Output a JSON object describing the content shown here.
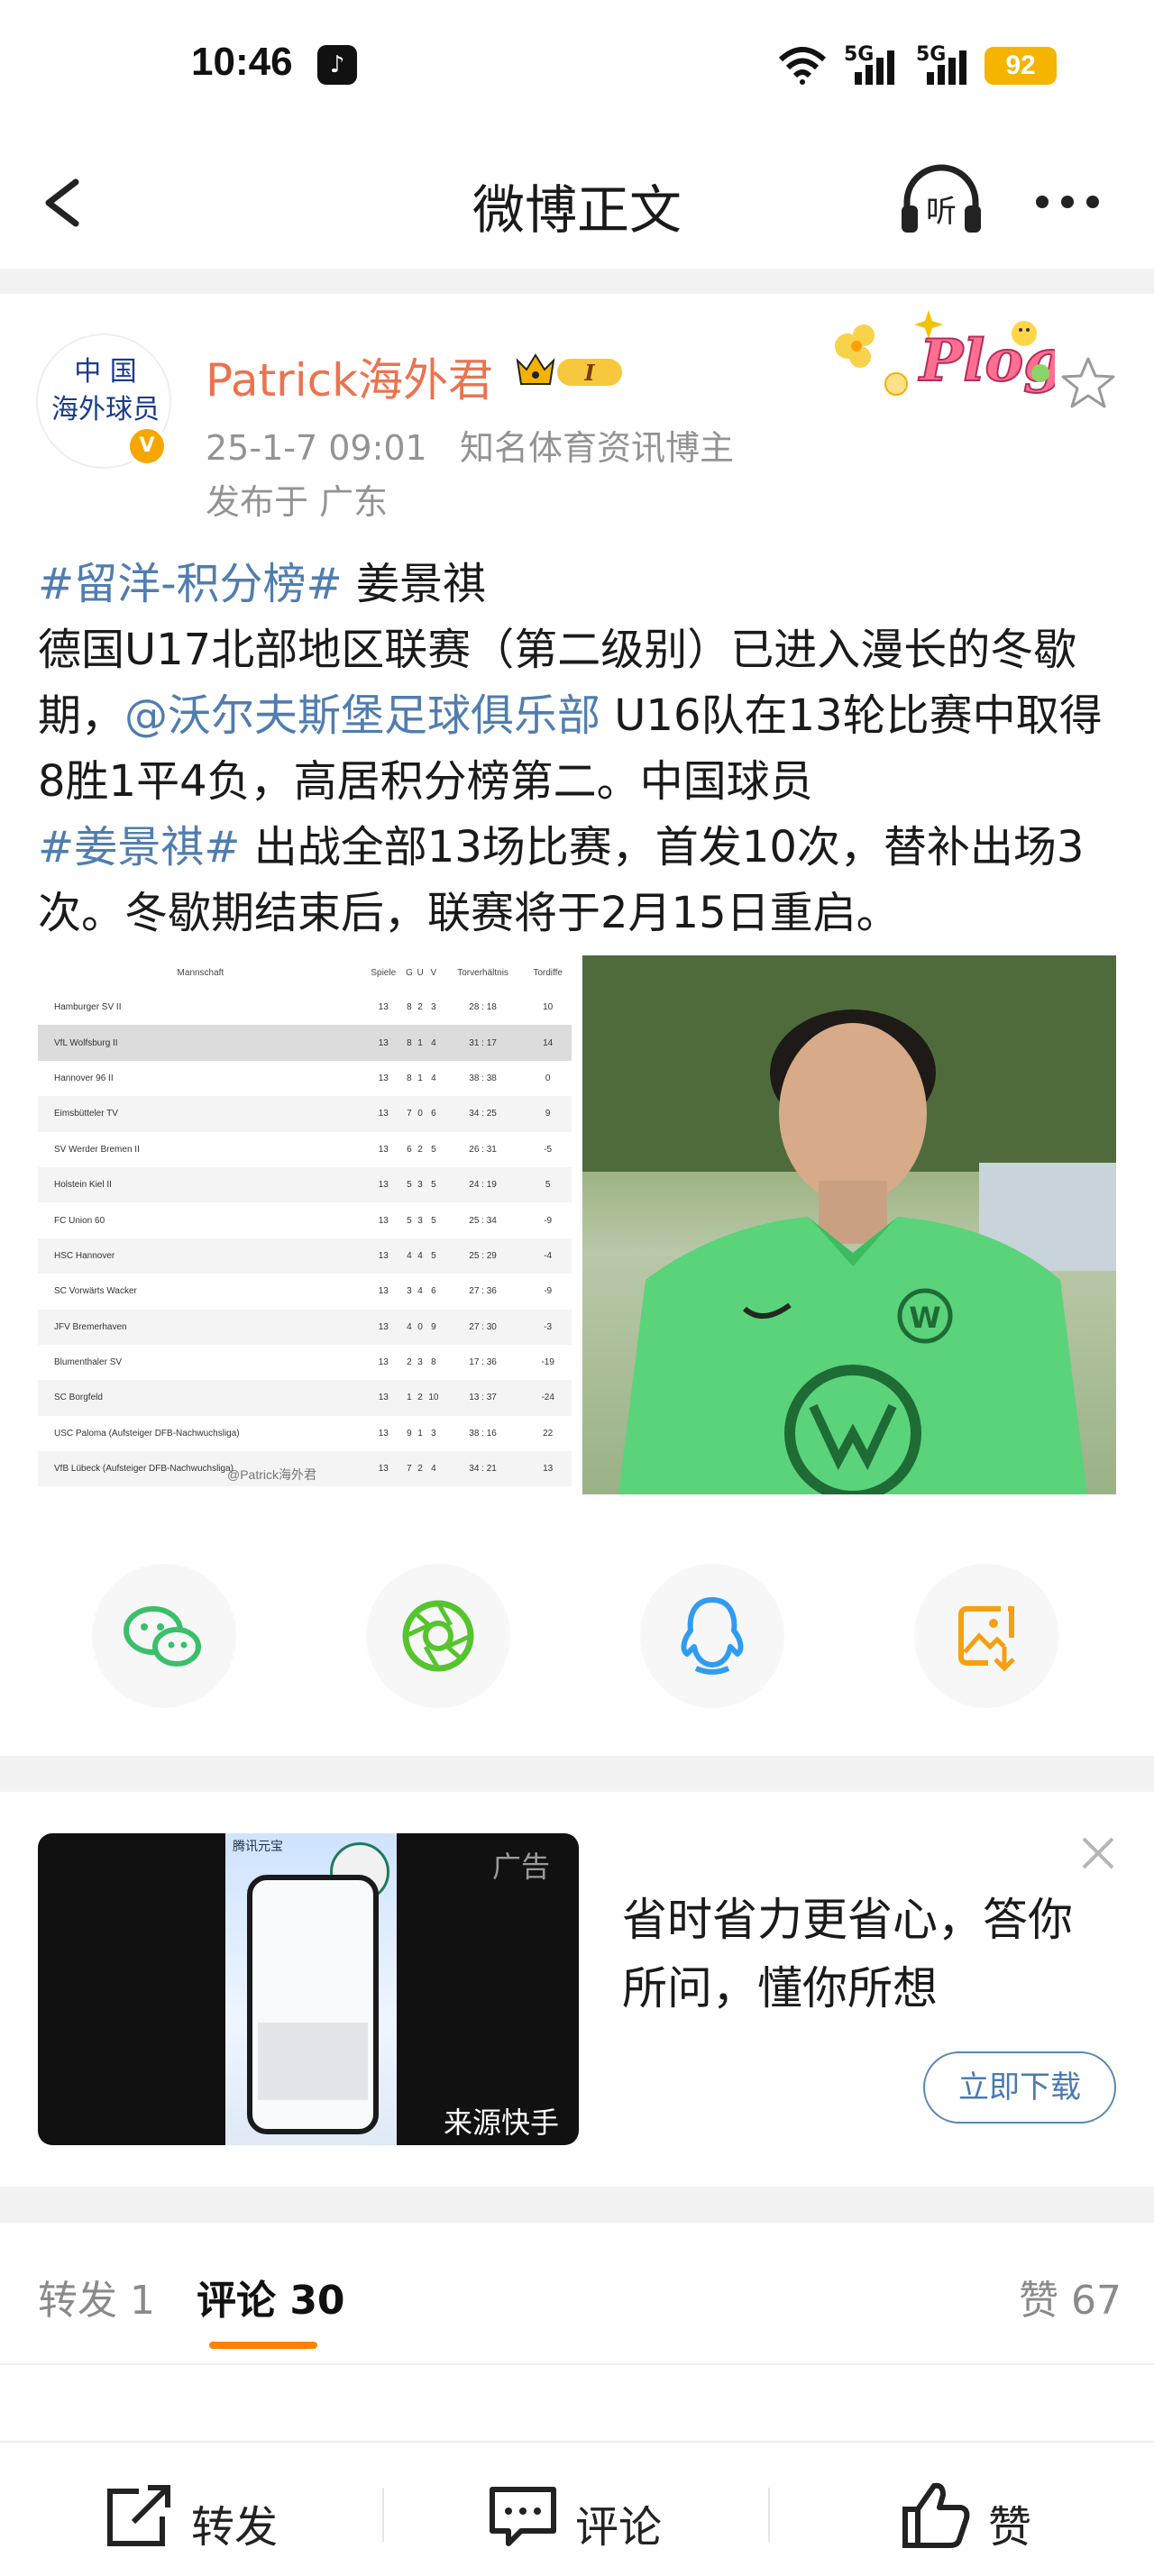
{
  "status_bar": {
    "time": "10:46",
    "signal1": "5G",
    "signal2": "5G",
    "battery": "92"
  },
  "nav": {
    "title": "微博正文"
  },
  "post": {
    "avatar_text_line1": "中 国",
    "avatar_text_line2": "海外球员",
    "username": "Patrick海外君",
    "vip_level": "I",
    "timestamp": "25-1-7 09:01",
    "author_title": "知名体育资讯博主",
    "location": "发布于 广东",
    "plog_label": "Plog",
    "body": {
      "tag1": "#留洋-积分榜#",
      "text1": " 姜景祺",
      "text2": "德国U17北部地区联赛（第二级别）已进入漫长的冬歇期，",
      "mention": "@沃尔夫斯堡足球俱乐部",
      "text3": " U16队在13轮比赛中取得8胜1平4负，高居积分榜第二。中国球员",
      "tag2": "#姜景祺#",
      "text4": " 出战全部13场比赛，首发10次，替补出场3次。冬歇期结束后，联赛将于2月15日重启。"
    },
    "table_image": {
      "headers": [
        "Mannschaft",
        "Spiele",
        "G",
        "U",
        "V",
        "Torverhältnis",
        "Tordiffe"
      ],
      "rows": [
        [
          "Hamburger SV II",
          "13",
          "8",
          "2",
          "3",
          "28 : 18",
          "10"
        ],
        [
          "VfL Wolfsburg II",
          "13",
          "8",
          "1",
          "4",
          "31 : 17",
          "14"
        ],
        [
          "Hannover 96 II",
          "13",
          "8",
          "1",
          "4",
          "38 : 38",
          "0"
        ],
        [
          "Eimsbütteler TV",
          "13",
          "7",
          "0",
          "6",
          "34 : 25",
          "9"
        ],
        [
          "SV Werder Bremen II",
          "13",
          "6",
          "2",
          "5",
          "26 : 31",
          "-5"
        ],
        [
          "Holstein Kiel II",
          "13",
          "5",
          "3",
          "5",
          "24 : 19",
          "5"
        ],
        [
          "FC Union 60",
          "13",
          "5",
          "3",
          "5",
          "25 : 34",
          "-9"
        ],
        [
          "HSC Hannover",
          "13",
          "4",
          "4",
          "5",
          "25 : 29",
          "-4"
        ],
        [
          "SC Vorwärts Wacker",
          "13",
          "3",
          "4",
          "6",
          "27 : 36",
          "-9"
        ],
        [
          "JFV Bremerhaven",
          "13",
          "4",
          "0",
          "9",
          "27 : 30",
          "-3"
        ],
        [
          "Blumenthaler SV",
          "13",
          "2",
          "3",
          "8",
          "17 : 36",
          "-19"
        ],
        [
          "SC Borgfeld",
          "13",
          "1",
          "2",
          "10",
          "13 : 37",
          "-24"
        ],
        [
          "USC Paloma (Aufsteiger DFB-Nachwuchsliga)",
          "13",
          "9",
          "1",
          "3",
          "38 : 16",
          "22"
        ],
        [
          "VfB Lübeck (Aufsteiger DFB-Nachwuchsliga)",
          "13",
          "7",
          "2",
          "4",
          "34 : 21",
          "13"
        ]
      ],
      "watermark": "@Patrick海外君"
    }
  },
  "share": {
    "items": [
      "wechat-icon",
      "moments-icon",
      "qq-icon",
      "save-image-icon"
    ]
  },
  "ad": {
    "label": "广告",
    "source": "来源快手",
    "text": "省时省力更省心，答你所问，懂你所想",
    "download_label": "立即下载",
    "phone_app_name": "腾讯元宝"
  },
  "tabs": {
    "forward": "转发 1",
    "comment": "评论 30",
    "like": "赞 67"
  },
  "bottom_bar": {
    "forward": "转发",
    "comment": "评论",
    "like": "赞"
  },
  "colors": {
    "username": "#eb7350",
    "link": "#507daf",
    "accent": "#ff8200",
    "battery": "#f5b400"
  }
}
